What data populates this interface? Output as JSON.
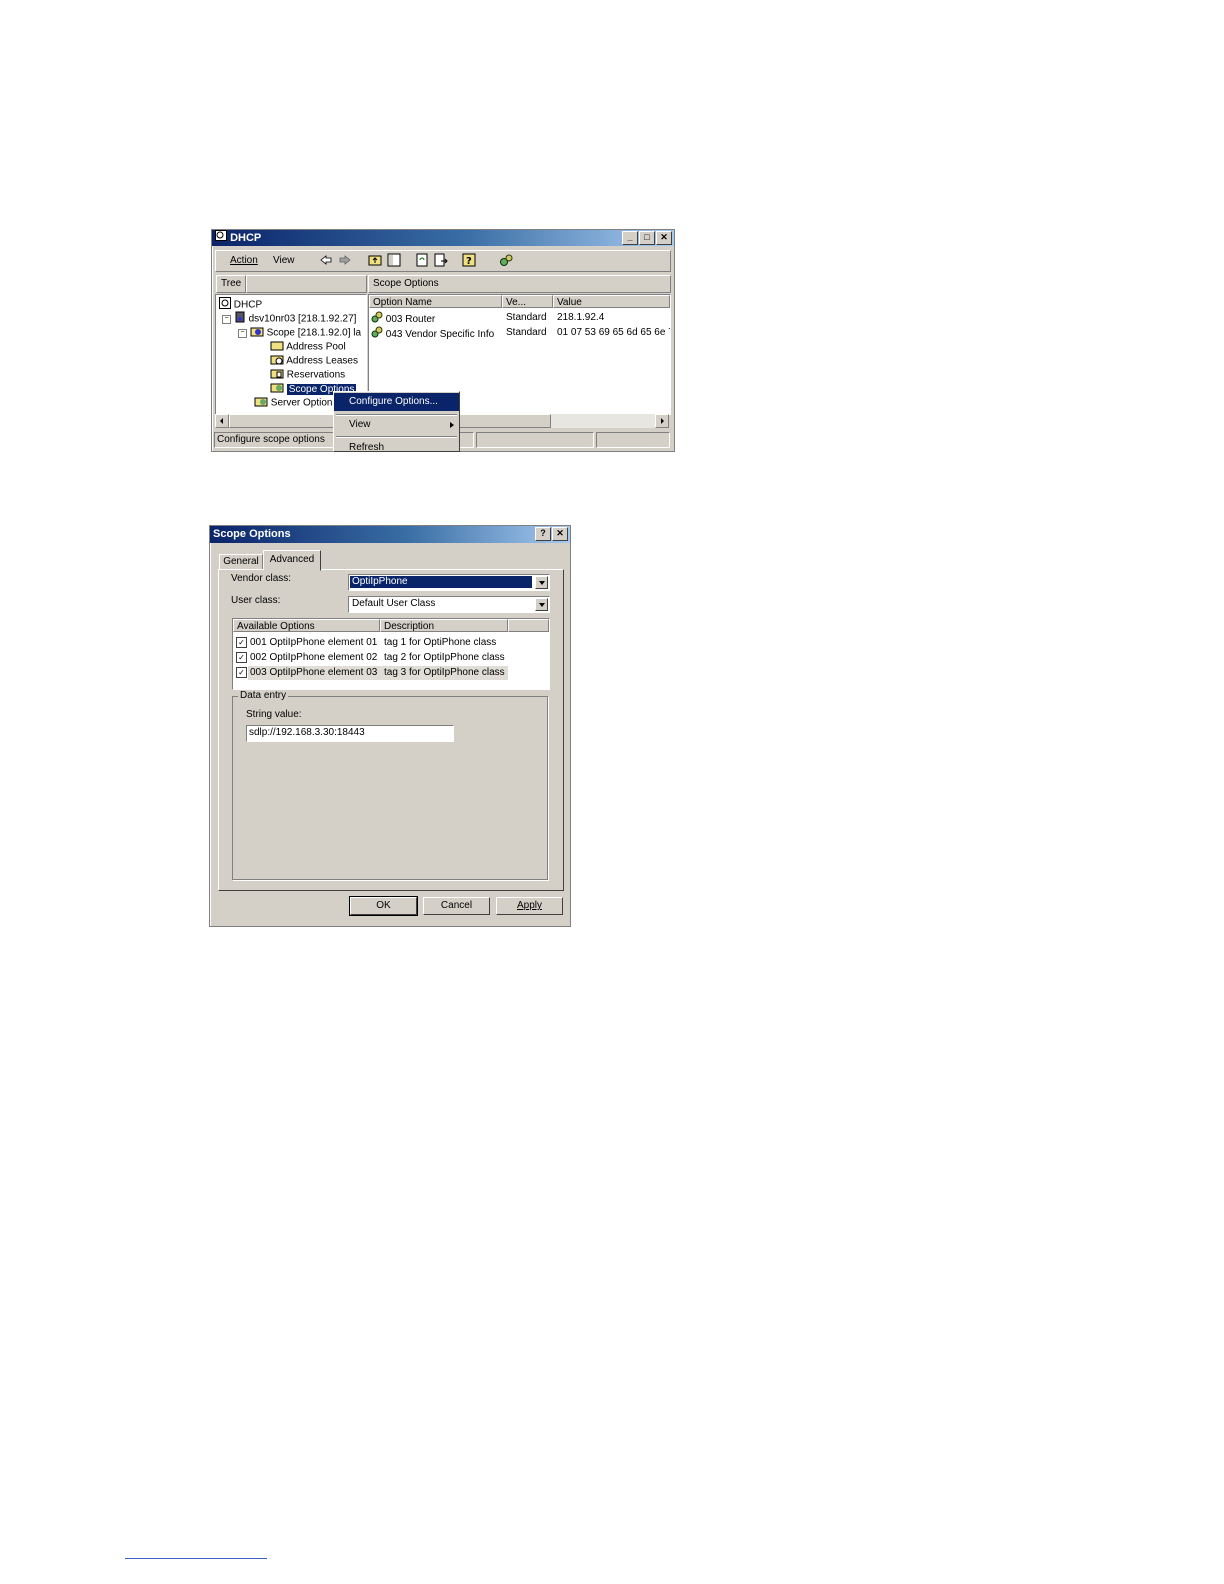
{
  "dhcp_window": {
    "title": "DHCP",
    "menu": {
      "action": "Action",
      "view": "View"
    },
    "tree_tab": "Tree",
    "tree": {
      "root": "DHCP",
      "server": "dsv10nr03 [218.1.92.27]",
      "scope": "Scope [218.1.92.0] la",
      "address_pool": "Address Pool",
      "address_leases": "Address Leases",
      "reservations": "Reservations",
      "scope_options": "Scope Options",
      "server_options": "Server Options"
    },
    "panel_title": "Scope Options",
    "columns": {
      "name": "Option Name",
      "vendor": "Ve...",
      "value": "Value"
    },
    "rows": [
      {
        "name": "003 Router",
        "vendor": "Standard",
        "value": "218.1.92.4"
      },
      {
        "name": "043 Vendor Specific Info",
        "vendor": "Standard",
        "value": "01 07 53 69 65 6d 65 6e 7"
      }
    ],
    "status": "Configure scope options",
    "context_menu": {
      "configure": "Configure Options...",
      "view": "View",
      "refresh": "Refresh"
    }
  },
  "scope_dialog": {
    "title": "Scope Options",
    "help_btn": "?",
    "close_btn": "✕",
    "tabs": {
      "general": "General",
      "advanced": "Advanced"
    },
    "vendor_label": "Vendor class:",
    "vendor_value": "OptiIpPhone",
    "user_label": "User class:",
    "user_value": "Default User Class",
    "columns": {
      "available": "Available Options",
      "description": "Description"
    },
    "options": [
      {
        "name": "001 OptiIpPhone element 01",
        "desc": "tag 1 for OptiPhone class"
      },
      {
        "name": "002 OptiIpPhone element 02",
        "desc": "tag 2 for OptiIpPhone class"
      },
      {
        "name": "003 OptiIpPhone element 03",
        "desc": "tag 3 for OptiIpPhone class"
      }
    ],
    "data_entry_label": "Data entry",
    "string_label": "String value:",
    "string_value": "sdlp://192.168.3.30:18443",
    "buttons": {
      "ok": "OK",
      "cancel": "Cancel",
      "apply": "Apply"
    }
  }
}
